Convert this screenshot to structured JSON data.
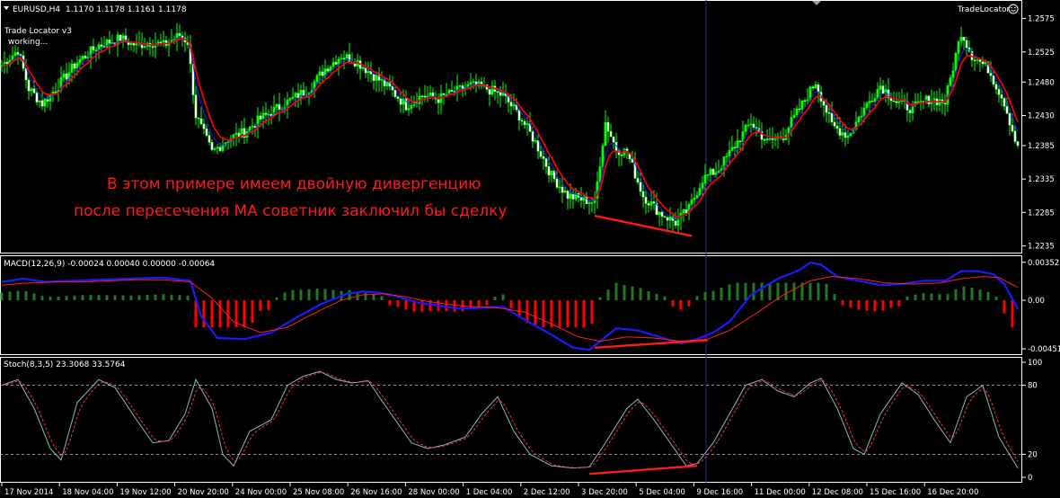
{
  "header": {
    "symbol_label": "EURUSD,H4",
    "ohlc": "1.1170 1.1178 1.1161 1.1178",
    "indicator_name": "TradeLocator",
    "ea_title": "Trade Locator v3",
    "ea_status": "working..."
  },
  "annotation": {
    "line1": "В этом примере имеем двойную дивергенцию",
    "line2": "после пересечения МА советник заключил бы сделку"
  },
  "colors": {
    "background": "#000000",
    "bull_candle": "#00ff00",
    "bear_candle": "#ffffff",
    "ma_red": "#ff0000",
    "ma_blue": "#1a1aff",
    "macd_pos": "#1f7a1f",
    "macd_neg": "#ff0000",
    "stoch_main": "#7fbfbf",
    "stoch_signal": "#ff3030",
    "grid_border": "#ffffff",
    "cursor_line": "#1e2a88"
  },
  "time_axis": [
    "17 Nov 2014",
    "18 Nov 04:00",
    "19 Nov 12:00",
    "20 Nov 20:00",
    "24 Nov 00:00",
    "25 Nov 08:00",
    "26 Nov 16:00",
    "28 Nov 00:00",
    "1 Dec 04:00",
    "2 Dec 12:00",
    "3 Dec 20:00",
    "5 Dec 04:00",
    "9 Dec 16:00",
    "11 Dec 00:00",
    "12 Dec 08:00",
    "15 Dec 16:00",
    "16 Dec 20:00"
  ],
  "chart_data": [
    {
      "type": "candlestick",
      "panel": "price",
      "title": "EURUSD,H4",
      "ylim": [
        1.2225,
        1.26
      ],
      "y_ticks": [
        1.2575,
        1.2525,
        1.248,
        1.243,
        1.2385,
        1.2335,
        1.2285,
        1.2235
      ],
      "close_anchors": [
        [
          0,
          1.2505
        ],
        [
          6,
          1.2528
        ],
        [
          10,
          1.247
        ],
        [
          15,
          1.2448
        ],
        [
          20,
          1.247
        ],
        [
          28,
          1.251
        ],
        [
          36,
          1.2535
        ],
        [
          44,
          1.2545
        ],
        [
          50,
          1.2535
        ],
        [
          55,
          1.254
        ],
        [
          60,
          1.2535
        ],
        [
          66,
          1.255
        ],
        [
          69,
          1.254
        ],
        [
          72,
          1.243
        ],
        [
          78,
          1.2375
        ],
        [
          84,
          1.2395
        ],
        [
          90,
          1.2405
        ],
        [
          96,
          1.2425
        ],
        [
          102,
          1.244
        ],
        [
          108,
          1.2455
        ],
        [
          114,
          1.247
        ],
        [
          120,
          1.25
        ],
        [
          126,
          1.252
        ],
        [
          132,
          1.251
        ],
        [
          138,
          1.249
        ],
        [
          144,
          1.247
        ],
        [
          150,
          1.2445
        ],
        [
          156,
          1.246
        ],
        [
          162,
          1.2455
        ],
        [
          168,
          1.2465
        ],
        [
          174,
          1.2475
        ],
        [
          180,
          1.247
        ],
        [
          186,
          1.246
        ],
        [
          192,
          1.243
        ],
        [
          198,
          1.239
        ],
        [
          204,
          1.234
        ],
        [
          210,
          1.231
        ],
        [
          215,
          1.2305
        ],
        [
          220,
          1.23
        ],
        [
          224,
          1.242
        ],
        [
          228,
          1.238
        ],
        [
          232,
          1.2375
        ],
        [
          238,
          1.231
        ],
        [
          244,
          1.2285
        ],
        [
          250,
          1.227
        ],
        [
          255,
          1.229
        ],
        [
          260,
          1.2335
        ],
        [
          266,
          1.235
        ],
        [
          272,
          1.2385
        ],
        [
          278,
          1.242
        ],
        [
          284,
          1.239
        ],
        [
          290,
          1.24
        ],
        [
          296,
          1.244
        ],
        [
          302,
          1.248
        ],
        [
          308,
          1.2415
        ],
        [
          314,
          1.24
        ],
        [
          320,
          1.244
        ],
        [
          326,
          1.2475
        ],
        [
          332,
          1.245
        ],
        [
          338,
          1.244
        ],
        [
          344,
          1.2455
        ],
        [
          350,
          1.245
        ],
        [
          356,
          1.2555
        ],
        [
          360,
          1.252
        ],
        [
          366,
          1.25
        ],
        [
          372,
          1.245
        ],
        [
          377,
          1.238
        ]
      ],
      "series": [
        {
          "name": "MA red",
          "color": "#ff0000"
        },
        {
          "name": "MA blue",
          "color": "#1a1aff"
        }
      ],
      "divergence_line": {
        "from": [
          220,
          1.228
        ],
        "to": [
          256,
          1.225
        ]
      }
    },
    {
      "type": "bar",
      "panel": "macd",
      "title": "MACD(12,26,9) -0.00024 0.00040 0.00000 -0.00064",
      "ylim": [
        -0.005,
        0.004
      ],
      "y_ticks": [
        0.00352,
        0.0,
        -0.00451
      ],
      "y_tick_labels": [
        "0.00352",
        "0.00",
        "-0.00451"
      ],
      "main_anchors": [
        [
          0,
          0.0017
        ],
        [
          8,
          0.002
        ],
        [
          16,
          0.0017
        ],
        [
          26,
          0.0018
        ],
        [
          36,
          0.0019
        ],
        [
          48,
          0.002
        ],
        [
          60,
          0.0021
        ],
        [
          70,
          0.0018
        ],
        [
          74,
          -0.0015
        ],
        [
          80,
          -0.0035
        ],
        [
          90,
          -0.0036
        ],
        [
          100,
          -0.003
        ],
        [
          108,
          -0.0018
        ],
        [
          118,
          -0.0004
        ],
        [
          128,
          0.0006
        ],
        [
          134,
          0.0008
        ],
        [
          140,
          0.0007
        ],
        [
          146,
          0.0004
        ],
        [
          154,
          -0.0002
        ],
        [
          162,
          -0.0005
        ],
        [
          170,
          -0.0008
        ],
        [
          178,
          -0.0007
        ],
        [
          186,
          -0.0006
        ],
        [
          194,
          -0.0018
        ],
        [
          204,
          -0.0032
        ],
        [
          212,
          -0.0044
        ],
        [
          218,
          -0.0046
        ],
        [
          222,
          -0.0038
        ],
        [
          228,
          -0.0026
        ],
        [
          236,
          -0.0028
        ],
        [
          244,
          -0.0034
        ],
        [
          252,
          -0.004
        ],
        [
          258,
          -0.0036
        ],
        [
          264,
          -0.003
        ],
        [
          270,
          -0.002
        ],
        [
          278,
          0.0005
        ],
        [
          288,
          0.002
        ],
        [
          296,
          0.0028
        ],
        [
          300,
          0.0035
        ],
        [
          304,
          0.0033
        ],
        [
          310,
          0.0022
        ],
        [
          318,
          0.0018
        ],
        [
          326,
          0.0014
        ],
        [
          334,
          0.0015
        ],
        [
          342,
          0.0018
        ],
        [
          350,
          0.0018
        ],
        [
          356,
          0.0027
        ],
        [
          362,
          0.0027
        ],
        [
          368,
          0.0024
        ],
        [
          372,
          0.0015
        ],
        [
          377,
          -0.0008
        ]
      ],
      "signal_anchors": [
        [
          0,
          0.0014
        ],
        [
          10,
          0.0016
        ],
        [
          20,
          0.0017
        ],
        [
          30,
          0.0017
        ],
        [
          40,
          0.0018
        ],
        [
          50,
          0.0019
        ],
        [
          60,
          0.0019
        ],
        [
          70,
          0.0017
        ],
        [
          78,
          0.0002
        ],
        [
          86,
          -0.002
        ],
        [
          96,
          -0.003
        ],
        [
          106,
          -0.0025
        ],
        [
          116,
          -0.0012
        ],
        [
          126,
          0.0
        ],
        [
          134,
          0.0005
        ],
        [
          142,
          0.0006
        ],
        [
          150,
          0.0003
        ],
        [
          158,
          -0.0001
        ],
        [
          166,
          -0.0004
        ],
        [
          174,
          -0.0006
        ],
        [
          184,
          -0.0007
        ],
        [
          194,
          -0.0011
        ],
        [
          204,
          -0.0022
        ],
        [
          214,
          -0.0034
        ],
        [
          222,
          -0.0038
        ],
        [
          232,
          -0.0034
        ],
        [
          242,
          -0.0035
        ],
        [
          252,
          -0.0038
        ],
        [
          262,
          -0.0036
        ],
        [
          270,
          -0.0028
        ],
        [
          280,
          -0.0012
        ],
        [
          290,
          0.0005
        ],
        [
          300,
          0.0018
        ],
        [
          308,
          0.0022
        ],
        [
          318,
          0.002
        ],
        [
          328,
          0.0016
        ],
        [
          338,
          0.0015
        ],
        [
          348,
          0.0016
        ],
        [
          356,
          0.002
        ],
        [
          364,
          0.0022
        ],
        [
          370,
          0.0021
        ],
        [
          377,
          0.0012
        ]
      ],
      "divergence_line": {
        "from": [
          220,
          -0.0044
        ],
        "to": [
          262,
          -0.0037
        ]
      }
    },
    {
      "type": "line",
      "panel": "stochastic",
      "title": "Stoch(8,3,5) 23.3068 33.5764",
      "ylim": [
        0,
        100
      ],
      "y_ticks": [
        100,
        80,
        20,
        0
      ],
      "levels": [
        80,
        20
      ],
      "main_anchors": [
        [
          0,
          80
        ],
        [
          6,
          85
        ],
        [
          12,
          60
        ],
        [
          18,
          25
        ],
        [
          22,
          15
        ],
        [
          28,
          65
        ],
        [
          36,
          85
        ],
        [
          42,
          78
        ],
        [
          50,
          50
        ],
        [
          56,
          30
        ],
        [
          62,
          32
        ],
        [
          68,
          55
        ],
        [
          72,
          85
        ],
        [
          78,
          60
        ],
        [
          82,
          20
        ],
        [
          86,
          10
        ],
        [
          92,
          40
        ],
        [
          100,
          50
        ],
        [
          106,
          80
        ],
        [
          112,
          88
        ],
        [
          118,
          92
        ],
        [
          124,
          85
        ],
        [
          130,
          82
        ],
        [
          136,
          84
        ],
        [
          140,
          70
        ],
        [
          146,
          50
        ],
        [
          152,
          30
        ],
        [
          158,
          25
        ],
        [
          164,
          28
        ],
        [
          172,
          35
        ],
        [
          178,
          55
        ],
        [
          184,
          70
        ],
        [
          190,
          40
        ],
        [
          196,
          20
        ],
        [
          204,
          10
        ],
        [
          212,
          8
        ],
        [
          218,
          9
        ],
        [
          224,
          30
        ],
        [
          232,
          60
        ],
        [
          236,
          68
        ],
        [
          242,
          50
        ],
        [
          248,
          30
        ],
        [
          254,
          10
        ],
        [
          258,
          12
        ],
        [
          264,
          30
        ],
        [
          270,
          55
        ],
        [
          276,
          80
        ],
        [
          282,
          85
        ],
        [
          288,
          75
        ],
        [
          294,
          70
        ],
        [
          300,
          82
        ],
        [
          304,
          86
        ],
        [
          310,
          60
        ],
        [
          316,
          25
        ],
        [
          320,
          20
        ],
        [
          326,
          55
        ],
        [
          334,
          82
        ],
        [
          340,
          72
        ],
        [
          346,
          50
        ],
        [
          352,
          30
        ],
        [
          358,
          70
        ],
        [
          364,
          80
        ],
        [
          370,
          35
        ],
        [
          377,
          8
        ]
      ],
      "series": [
        {
          "name": "Main",
          "color": "#7fbfbf"
        },
        {
          "name": "Signal",
          "color": "#ff3030"
        }
      ],
      "divergence_line": {
        "from": [
          218,
          3
        ],
        "to": [
          258,
          10
        ]
      }
    }
  ]
}
